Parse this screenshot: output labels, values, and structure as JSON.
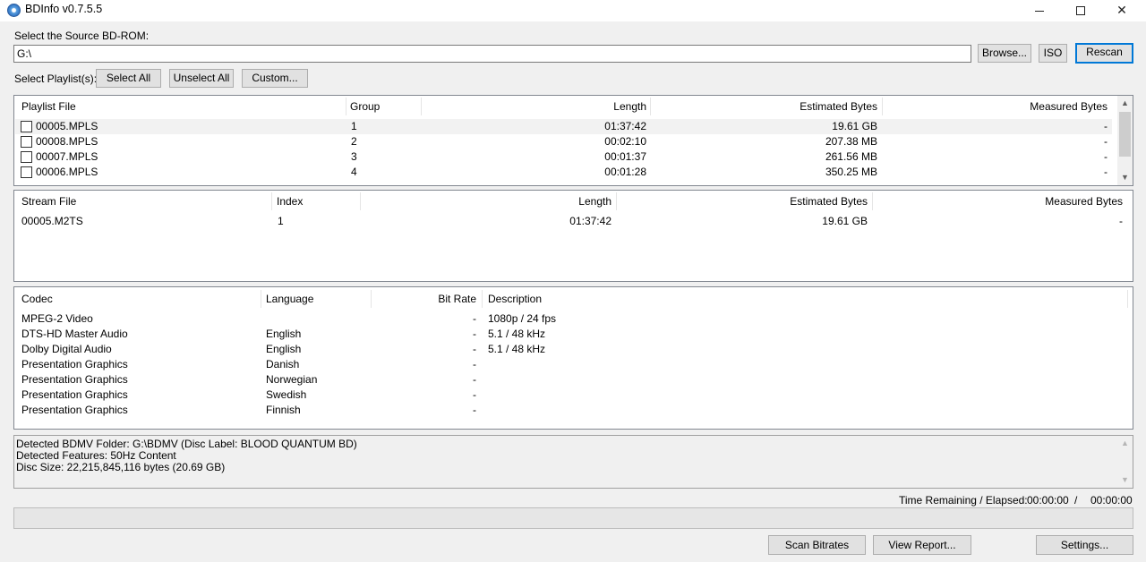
{
  "window": {
    "title": "BDInfo v0.7.5.5"
  },
  "source": {
    "label": "Select the Source BD-ROM:",
    "path": "G:\\"
  },
  "buttons": {
    "browse": "Browse...",
    "iso": "ISO",
    "rescan": "Rescan",
    "select_all": "Select All",
    "unselect_all": "Unselect All",
    "custom": "Custom...",
    "scan_bitrates": "Scan Bitrates",
    "view_report": "View Report...",
    "settings": "Settings..."
  },
  "playlist_label": "Select Playlist(s):",
  "playlists": {
    "headers": [
      "Playlist File",
      "Group",
      "Length",
      "Estimated Bytes",
      "Measured Bytes"
    ],
    "rows": [
      {
        "file": "00005.MPLS",
        "group": "1",
        "length": "01:37:42",
        "est": "19.61 GB",
        "meas": "-"
      },
      {
        "file": "00008.MPLS",
        "group": "2",
        "length": "00:02:10",
        "est": "207.38 MB",
        "meas": "-"
      },
      {
        "file": "00007.MPLS",
        "group": "3",
        "length": "00:01:37",
        "est": "261.56 MB",
        "meas": "-"
      },
      {
        "file": "00006.MPLS",
        "group": "4",
        "length": "00:01:28",
        "est": "350.25 MB",
        "meas": "-"
      }
    ]
  },
  "streams": {
    "headers": [
      "Stream File",
      "Index",
      "Length",
      "Estimated Bytes",
      "Measured Bytes"
    ],
    "rows": [
      {
        "file": "00005.M2TS",
        "index": "1",
        "length": "01:37:42",
        "est": "19.61 GB",
        "meas": "-"
      }
    ]
  },
  "codecs": {
    "headers": [
      "Codec",
      "Language",
      "Bit Rate",
      "Description"
    ],
    "rows": [
      {
        "codec": "MPEG-2 Video",
        "lang": "",
        "rate": "-",
        "desc": "1080p / 24 fps"
      },
      {
        "codec": "DTS-HD Master Audio",
        "lang": "English",
        "rate": "-",
        "desc": "5.1 / 48 kHz"
      },
      {
        "codec": "Dolby Digital Audio",
        "lang": "English",
        "rate": "-",
        "desc": "5.1 / 48 kHz"
      },
      {
        "codec": "Presentation Graphics",
        "lang": "Danish",
        "rate": "-",
        "desc": ""
      },
      {
        "codec": "Presentation Graphics",
        "lang": "Norwegian",
        "rate": "-",
        "desc": ""
      },
      {
        "codec": "Presentation Graphics",
        "lang": "Swedish",
        "rate": "-",
        "desc": ""
      },
      {
        "codec": "Presentation Graphics",
        "lang": "Finnish",
        "rate": "-",
        "desc": ""
      }
    ]
  },
  "info": [
    "Detected BDMV Folder: G:\\BDMV (Disc Label: BLOOD QUANTUM BD)",
    "Detected Features: 50Hz Content",
    "Disc Size: 22,215,845,116 bytes (20.69 GB)"
  ],
  "time": {
    "label": "Time Remaining / Elapsed:",
    "remaining": "00:00:00",
    "separator": "/",
    "elapsed": "00:00:00"
  },
  "progress": {
    "value": 0
  }
}
